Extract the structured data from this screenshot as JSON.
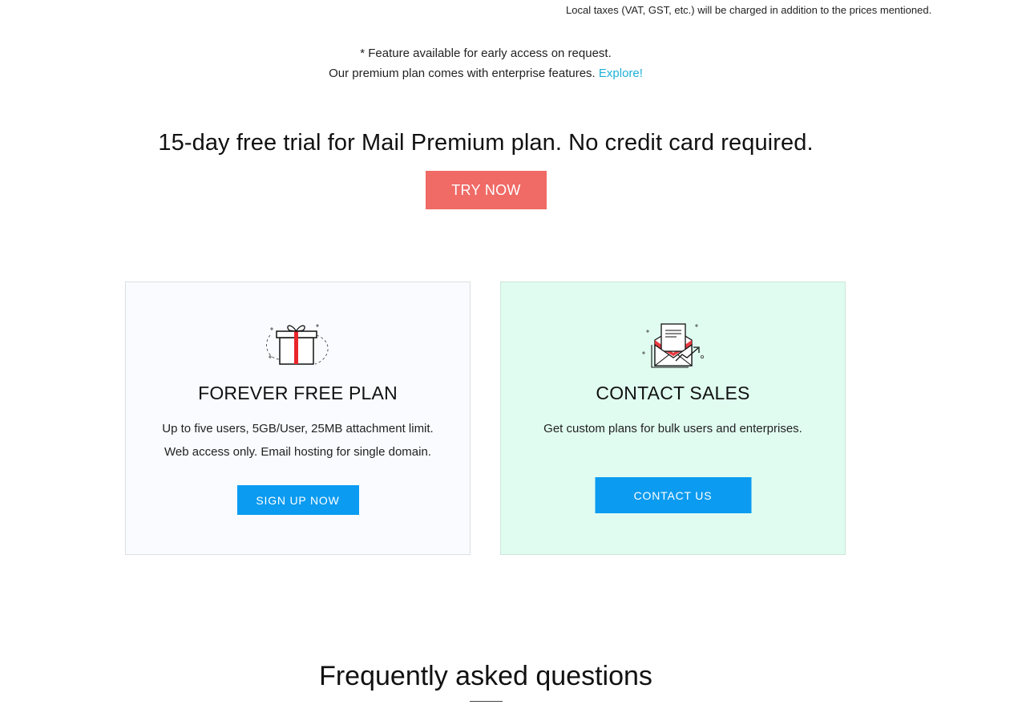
{
  "tax_note": "Local taxes (VAT, GST, etc.) will be charged in addition to the prices mentioned.",
  "notes": {
    "early_access": "* Feature available for early access on request.",
    "premium_text": "Our premium plan comes with enterprise features.",
    "explore_link": "Explore!"
  },
  "trial": {
    "heading": "15-day free trial for Mail Premium plan. No credit card required.",
    "button_label": "TRY NOW"
  },
  "cards": {
    "free": {
      "icon": "gift-icon",
      "title": "FOREVER FREE PLAN",
      "desc_line1": "Up to five users, 5GB/User, 25MB attachment limit.",
      "desc_line2": "Web access only. Email hosting for single domain.",
      "button_label": "SIGN UP NOW"
    },
    "sales": {
      "icon": "envelope-icon",
      "title": "CONTACT SALES",
      "desc": "Get custom plans for bulk users and enterprises.",
      "button_label": "CONTACT US"
    }
  },
  "faq": {
    "heading": "Frequently asked questions"
  },
  "colors": {
    "try_button": "#f06a66",
    "primary_button": "#0b9bf0",
    "link": "#1fb0d8",
    "free_card_bg": "#f9fbfe",
    "sales_card_bg": "#e0fcf1",
    "gift_ribbon": "#e8262c"
  }
}
